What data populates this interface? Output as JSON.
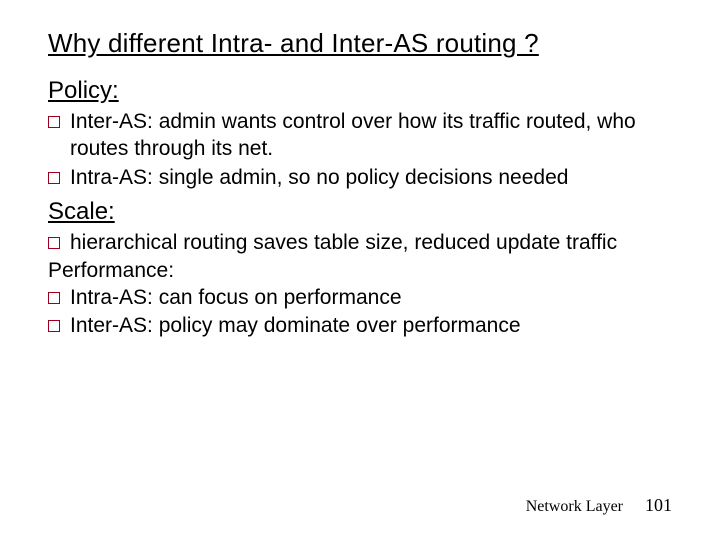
{
  "title": "Why different Intra- and Inter-AS routing ?",
  "sections": {
    "policy": {
      "heading": "Policy:",
      "bullets": [
        "Inter-AS: admin wants control over how its traffic routed, who routes through its net.",
        "Intra-AS: single admin, so no policy decisions needed"
      ]
    },
    "scale": {
      "heading": "Scale:",
      "bullets": [
        "hierarchical routing saves table size, reduced update traffic"
      ]
    },
    "performance": {
      "heading": "Performance:",
      "bullets": [
        "Intra-AS: can focus on performance",
        "Inter-AS: policy may dominate over performance"
      ]
    }
  },
  "footer": {
    "label": "Network Layer",
    "page": "101"
  }
}
